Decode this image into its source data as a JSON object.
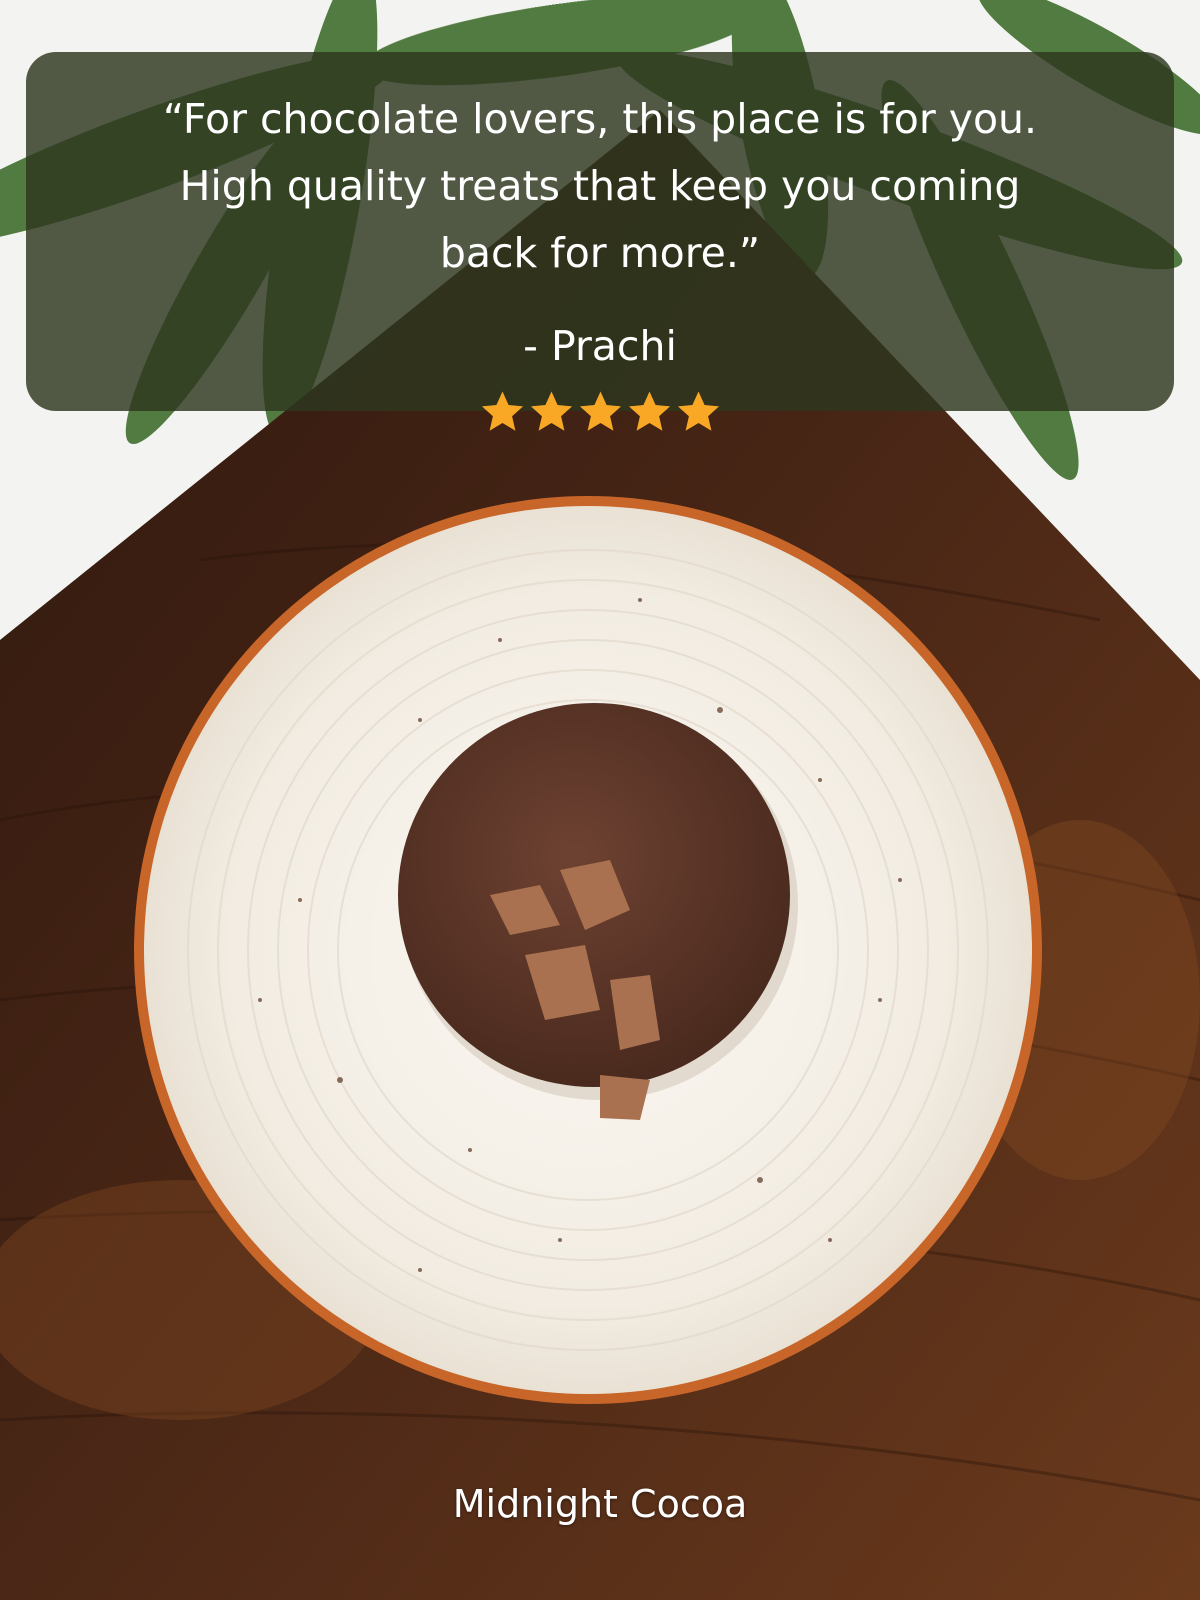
{
  "review": {
    "quote_lines": [
      "“For chocolate lovers, this place is for you.",
      "High quality treats that keep you coming",
      "back for more.”"
    ],
    "author": "- Prachi",
    "rating": 5,
    "rating_max": 5,
    "star_color": "#F9A825"
  },
  "product": {
    "name": "Midnight Cocoa"
  },
  "colors": {
    "card_background": "rgba(45, 55, 30, 0.82)",
    "wood": "#3a2014",
    "plate": "#f4efe6",
    "plate_rim": "#c8662a",
    "cookie": "#5a3426"
  }
}
